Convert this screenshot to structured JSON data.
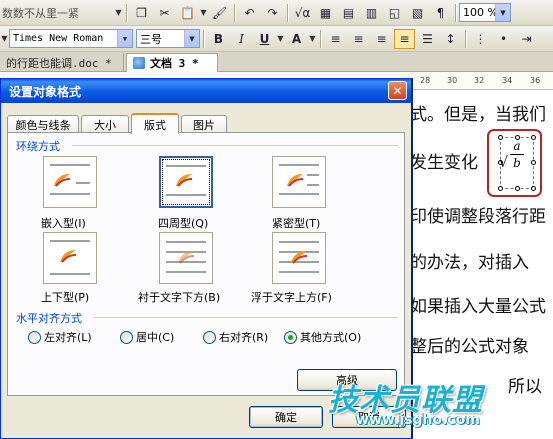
{
  "window": {
    "title_fragment": "数数不从里一紧"
  },
  "toolbar1": {
    "zoom_value": "100 %"
  },
  "toolbar2": {
    "font_name": "Times New Roman",
    "font_size": "三号"
  },
  "doc_tabs": [
    {
      "label": "的行距也能调.doc *"
    },
    {
      "label": "文档 3 *"
    }
  ],
  "ruler": {
    "numbers": [
      "28",
      "30",
      "32",
      "34",
      "36"
    ]
  },
  "document": {
    "lines": [
      "式。但是，当我们",
      "发生变化",
      "印使调整段落行距",
      "的办法，对插入",
      "如果插入大量公式",
      "整后的公式对象",
      "所以"
    ]
  },
  "equation": {
    "top": "a",
    "bottom": "b"
  },
  "dialog": {
    "title": "设置对象格式",
    "close_label": "✕",
    "tabs": [
      {
        "label": "颜色与线条"
      },
      {
        "label": "大小"
      },
      {
        "label": "版式"
      },
      {
        "label": "图片"
      }
    ],
    "wrap_group_label": "环绕方式",
    "wrap_options": [
      {
        "label": "嵌入型(I)"
      },
      {
        "label": "四周型(Q)"
      },
      {
        "label": "紧密型(T)"
      },
      {
        "label": "上下型(P)"
      },
      {
        "label": "衬于文字下方(B)"
      },
      {
        "label": "浮于文字上方(F)"
      }
    ],
    "align_group_label": "水平对齐方式",
    "align_options": [
      {
        "label": "左对齐(L)"
      },
      {
        "label": "居中(C)"
      },
      {
        "label": "右对齐(R)"
      },
      {
        "label": "其他方式(O)"
      }
    ],
    "advanced_label": "高级",
    "ok_label": "确定",
    "cancel_label": "取消"
  },
  "watermark": {
    "title": "技术员联盟",
    "url": "www.jsgho.com"
  },
  "colors": {
    "dialog_title_bar": "#0a5ae6",
    "selection_border": "#335ea8",
    "equation_highlight": "#b3262a",
    "watermark": "#1db0d0"
  }
}
